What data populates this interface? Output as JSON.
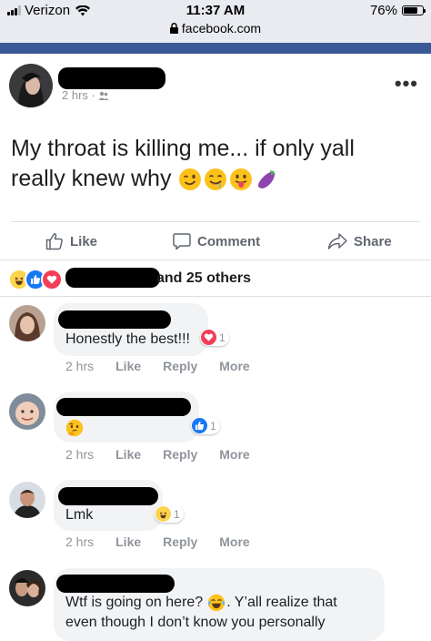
{
  "status_bar": {
    "carrier": "Verizon",
    "time": "11:37 AM",
    "url": "facebook.com",
    "battery": "76%",
    "battery_level": 0.76
  },
  "post": {
    "timestamp": "2 hrs ·",
    "more_menu": "•••",
    "text_line1": "My throat is killing me... if only yall",
    "text_line2": "really knew why",
    "emojis": [
      "winking-face",
      "drooling-face",
      "face-with-tongue",
      "eggplant"
    ]
  },
  "actions": {
    "like": "Like",
    "comment": "Comment",
    "share": "Share"
  },
  "reactions": {
    "icons": [
      "haha",
      "like",
      "love"
    ],
    "summary": "and 25 others"
  },
  "comments": [
    {
      "text": "Honestly the best!!!",
      "reaction": "love",
      "reaction_count": "1",
      "time": "2 hrs",
      "like": "Like",
      "reply": "Reply",
      "more": "More"
    },
    {
      "text": "",
      "emoji": "thinking-face",
      "reaction": "like",
      "reaction_count": "1",
      "time": "2 hrs",
      "like": "Like",
      "reply": "Reply",
      "more": "More"
    },
    {
      "text": "Lmk",
      "reaction": "haha",
      "reaction_count": "1",
      "time": "2 hrs",
      "like": "Like",
      "reply": "Reply",
      "more": "More"
    },
    {
      "text_line1": "Wtf is going on here?",
      "text_line1b": ". Y’all realize that",
      "text_line2": "even though I don’t know you personally",
      "emoji": "face-with-tears-of-joy"
    }
  ],
  "colors": {
    "facebook_blue": "#3b5998",
    "like_blue": "#1877f2",
    "love_red": "#f33e58",
    "haha_yellow": "#fcd34d",
    "muted_gray": "#90949c",
    "bubble_gray": "#f2f3f5"
  }
}
